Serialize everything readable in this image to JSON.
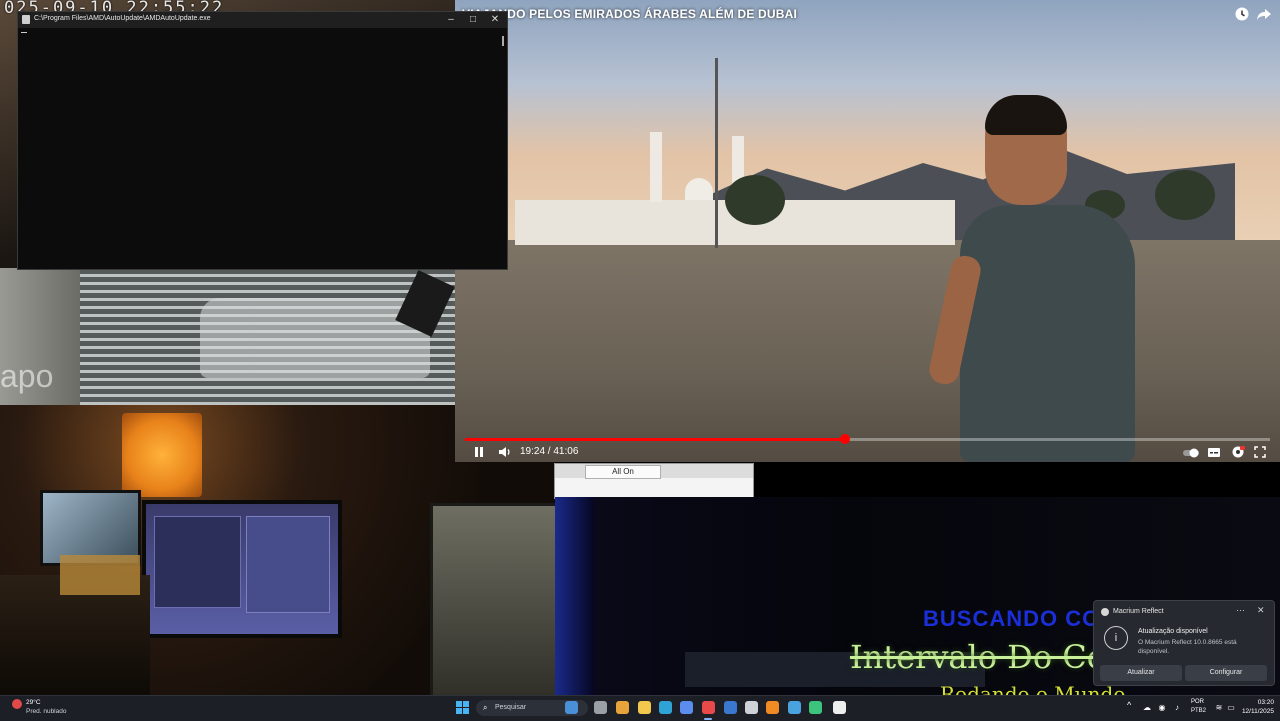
{
  "overlay": {
    "timestamp": "025-09-10  22:55:22"
  },
  "camera": {
    "watermark": "apo"
  },
  "video": {
    "title": "VIAJANDO PELOS EMIRADOS ÁRABES ALÉM DE DUBAI",
    "current_time": "19:24 / 41:06",
    "progress_fraction": 0.4721,
    "icons": {
      "clock": "watch-later-icon",
      "share": "share-icon",
      "pause": "pause-icon",
      "volume": "volume-icon",
      "autoplay": "autoplay-toggle-icon",
      "subtitles": "subtitles-icon",
      "settings": "settings-icon",
      "fullscreen": "fullscreen-icon"
    },
    "accent": "#ff0000"
  },
  "mini_window": {
    "button_label": "All On"
  },
  "stream": {
    "line1": "BUSCANDO CO",
    "line2": "Intervalo Do Co",
    "line2_tail": "»",
    "line3": "Rodando o Mundo"
  },
  "console": {
    "title": "C:\\Program Files\\AMD\\AutoUpdate\\AMDAutoUpdate.exe",
    "minimize": "–",
    "maximize": "□",
    "close": "✕"
  },
  "toast": {
    "app_name": "Macrium Reflect",
    "more": "···",
    "close": "✕",
    "title": "Atualização disponível",
    "body": "O Macrium Reflect 10.0.8665 está disponível.",
    "primary_button": "Atualizar",
    "secondary_button": "Configurar"
  },
  "taskbar": {
    "weather_temp": "29°C",
    "weather_desc": "Pred. nublado",
    "search_placeholder": "Pesquisar",
    "lang_top": "POR",
    "lang_bottom": "PTB2",
    "time": "03:20",
    "date": "12/11/2025",
    "apps": [
      {
        "name": "copilot-icon",
        "color": "#4a90d9"
      },
      {
        "name": "task-view-icon",
        "color": "#9aa0a6"
      },
      {
        "name": "chrome-icon",
        "color": "#e8a33a"
      },
      {
        "name": "file-explorer-icon",
        "color": "#f2c94c"
      },
      {
        "name": "edge-icon",
        "color": "#2fa3d6"
      },
      {
        "name": "store-icon",
        "color": "#5b8def"
      },
      {
        "name": "obs-icon",
        "color": "#e84a4a"
      },
      {
        "name": "mail-icon",
        "color": "#3a78d0"
      },
      {
        "name": "settings-app-icon",
        "color": "#cfd3d8"
      },
      {
        "name": "vlc-icon",
        "color": "#f08a24"
      },
      {
        "name": "photos-icon",
        "color": "#4aa3df"
      },
      {
        "name": "green-app-icon",
        "color": "#3cc47c"
      },
      {
        "name": "capcut-icon",
        "color": "#eeeeee"
      }
    ]
  }
}
